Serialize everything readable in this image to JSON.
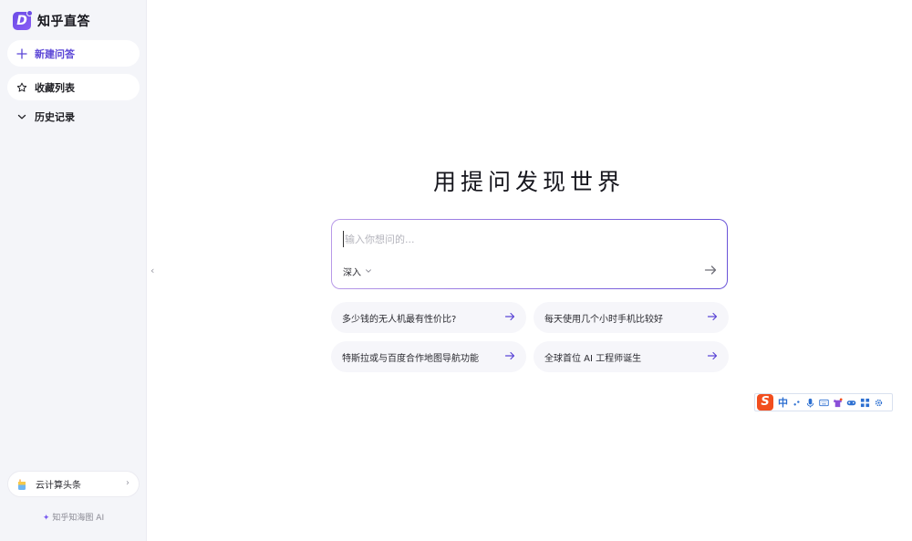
{
  "app": {
    "logo_letter": "D",
    "name": "知乎直答"
  },
  "sidebar": {
    "new_label": "新建问答",
    "favorites_label": "收藏列表",
    "history_label": "历史记录",
    "promo_label": "云计算头条",
    "footer": "知乎知海图 AI"
  },
  "main": {
    "title": "用提问发现世界",
    "search_placeholder": "输入你想问的...",
    "mode_label": "深入",
    "suggestions": [
      {
        "text": "多少钱的无人机最有性价比?"
      },
      {
        "text": "每天使用几个小时手机比较好"
      },
      {
        "text": "特斯拉或与百度合作地图导航功能"
      },
      {
        "text": "全球首位 AI 工程师诞生"
      }
    ]
  },
  "ime": {
    "logo": "S",
    "lang": "中"
  },
  "colors": {
    "accent": "#5b46d6",
    "border_gradient_start": "#b89ae8",
    "border_gradient_end": "#6a54d8",
    "sidebar_bg": "#f4f5f9",
    "ime_brand": "#f24e1e"
  }
}
